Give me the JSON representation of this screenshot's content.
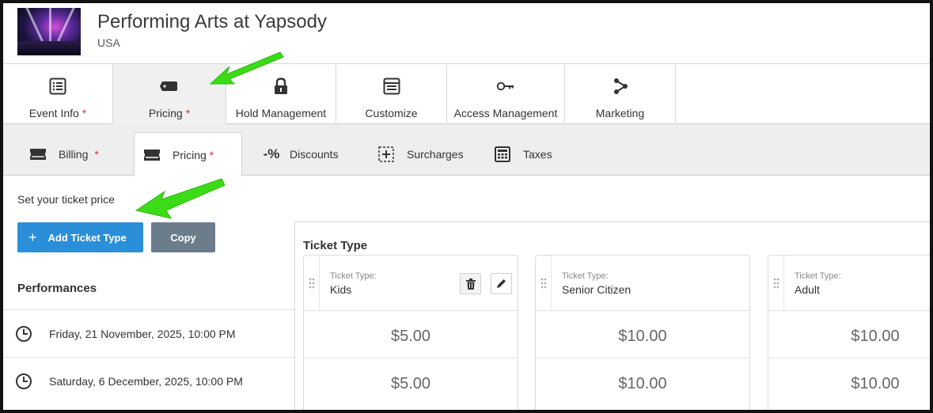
{
  "event": {
    "title": "Performing Arts at Yapsody",
    "location": "USA"
  },
  "top_tabs": [
    {
      "label": "Event Info",
      "required": "*",
      "icon": "list-icon"
    },
    {
      "label": "Pricing",
      "required": "*",
      "icon": "tag-icon",
      "active": true
    },
    {
      "label": "Hold Management",
      "icon": "lock-icon"
    },
    {
      "label": "Customize",
      "icon": "layout-icon"
    },
    {
      "label": "Access Management",
      "icon": "key-icon"
    },
    {
      "label": "Marketing",
      "icon": "share-icon"
    }
  ],
  "sub_tabs": [
    {
      "label": "Billing",
      "required": "*",
      "icon": "ticket-icon"
    },
    {
      "label": "Pricing",
      "required": "*",
      "icon": "ticket-icon",
      "active": true
    },
    {
      "label": "Discounts",
      "icon": "percent-icon"
    },
    {
      "label": "Surcharges",
      "icon": "add-box-icon"
    },
    {
      "label": "Taxes",
      "icon": "calculator-icon"
    }
  ],
  "pricing": {
    "instruction": "Set your ticket price",
    "add_button": "Add Ticket Type",
    "copy_button": "Copy",
    "performances_heading": "Performances",
    "ticket_type_heading": "Ticket Type",
    "ticket_type_label": "Ticket Type:"
  },
  "performances": [
    {
      "date": "Friday, 21 November, 2025, 10:00 PM"
    },
    {
      "date": "Saturday, 6 December, 2025, 10:00 PM"
    }
  ],
  "ticket_types": [
    {
      "name": "Kids",
      "prices": [
        "$5.00",
        "$5.00"
      ]
    },
    {
      "name": "Senior Citizen",
      "prices": [
        "$10.00",
        "$10.00"
      ]
    },
    {
      "name": "Adult",
      "prices": [
        "$10.00",
        "$10.00"
      ]
    }
  ],
  "colors": {
    "primary_button": "#2a8fd8",
    "secondary_button": "#6b7d8a",
    "required_mark": "#e03131",
    "annotation_arrow": "#3bdc17"
  }
}
